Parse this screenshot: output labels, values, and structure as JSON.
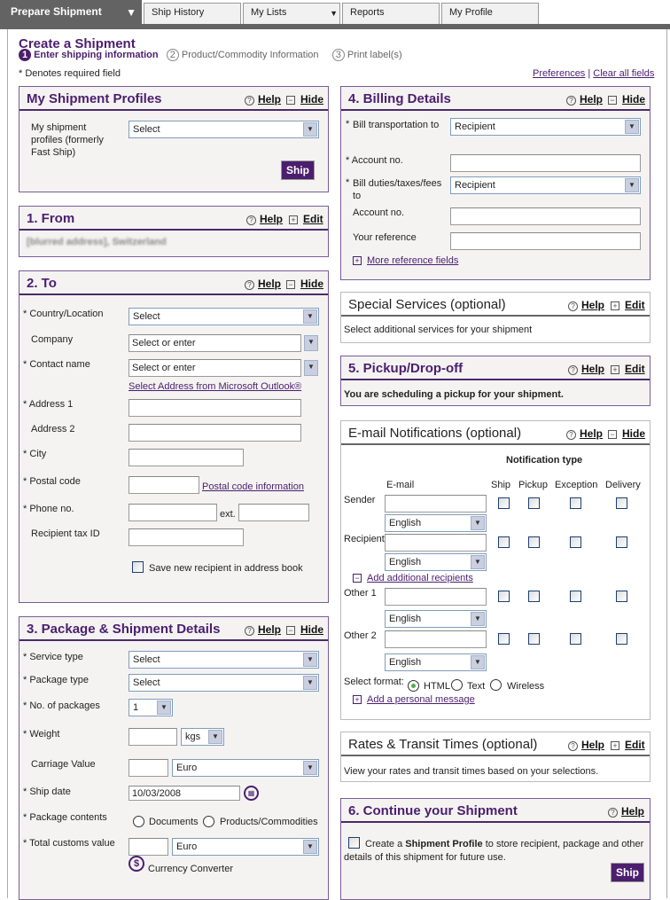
{
  "tabs": [
    "Prepare Shipment",
    "Ship History",
    "My Lists",
    "Reports",
    "My Profile"
  ],
  "header": {
    "title": "Create a Shipment",
    "steps": [
      {
        "num": "1",
        "label": "Enter shipping information"
      },
      {
        "num": "2",
        "label": "Product/Commodity Information"
      },
      {
        "num": "3",
        "label": "Print label(s)"
      }
    ],
    "required_note": "* Denotes required field",
    "preferences": "Preferences",
    "separator": "|",
    "clear_all": "Clear all fields"
  },
  "common": {
    "help": "Help",
    "hide": "Hide",
    "edit": "Edit",
    "req": "*"
  },
  "profiles": {
    "title": "My Shipment Profiles",
    "label": "My shipment profiles (formerly Fast Ship)",
    "select": "Select",
    "ship": "Ship"
  },
  "from": {
    "title": "1. From",
    "address": "[blurred address], Switzerland"
  },
  "to": {
    "title": "2. To",
    "country": "Country/Location",
    "country_val": "Select",
    "company": "Company",
    "company_val": "Select or enter",
    "contact": "Contact name",
    "contact_val": "Select or enter",
    "outlook_link": "Select Address from Microsoft Outlook®",
    "address1": "Address 1",
    "address2": "Address 2",
    "city": "City",
    "postal": "Postal code",
    "postal_link": "Postal code information",
    "phone": "Phone no.",
    "ext": "ext.",
    "tax": "Recipient tax ID",
    "save": "Save new recipient in address book"
  },
  "package": {
    "title": "3. Package & Shipment Details",
    "service": "Service type",
    "service_val": "Select",
    "ptype": "Package type",
    "ptype_val": "Select",
    "num": "No. of packages",
    "num_val": "1",
    "weight": "Weight",
    "weight_unit": "kgs",
    "carriage": "Carriage Value",
    "carriage_cur": "Euro",
    "date": "Ship date",
    "date_val": "10/03/2008",
    "contents": "Package contents",
    "documents": "Documents",
    "products": "Products/Commodities",
    "customs": "Total customs value",
    "customs_cur": "Euro",
    "converter": "Currency Converter"
  },
  "billing": {
    "title": "4. Billing Details",
    "bill_to": "Bill transportation to",
    "bill_to_val": "Recipient",
    "account": "Account no.",
    "duties": "Bill duties/taxes/fees to",
    "duties_val": "Recipient",
    "account2": "Account no.",
    "reference": "Your reference",
    "more": "More reference fields"
  },
  "special": {
    "title": "Special Services (optional)",
    "text": "Select additional services for your shipment"
  },
  "pickup": {
    "title": "5. Pickup/Drop-off",
    "text": "You are scheduling a pickup for your shipment."
  },
  "email": {
    "title": "E-mail Notifications (optional)",
    "notif_type": "Notification type",
    "col_email": "E-mail",
    "cols": [
      "Ship",
      "Pickup",
      "Exception",
      "Delivery"
    ],
    "rows": [
      {
        "label": "Sender",
        "lang": "English"
      },
      {
        "label": "Recipient",
        "lang": "English"
      },
      {
        "label": "Other 1",
        "lang": "English"
      },
      {
        "label": "Other 2",
        "lang": "English"
      }
    ],
    "add_recipients": "Add additional recipients",
    "format_label": "Select format:",
    "formats": [
      "HTML",
      "Text",
      "Wireless"
    ],
    "selected_format": "HTML",
    "personal": "Add a personal message"
  },
  "rates": {
    "title": "Rates & Transit Times (optional)",
    "text": "View your rates and transit times based on your selections."
  },
  "cont": {
    "title": "6. Continue your Shipment",
    "text_a": "Create a ",
    "text_b": "Shipment Profile",
    "text_c": " to store recipient, package and other",
    "text_d": "details of this shipment for future use.",
    "ship": "Ship"
  },
  "colors": {
    "brand": "#4b1e6e",
    "tabbar": "#636363"
  }
}
